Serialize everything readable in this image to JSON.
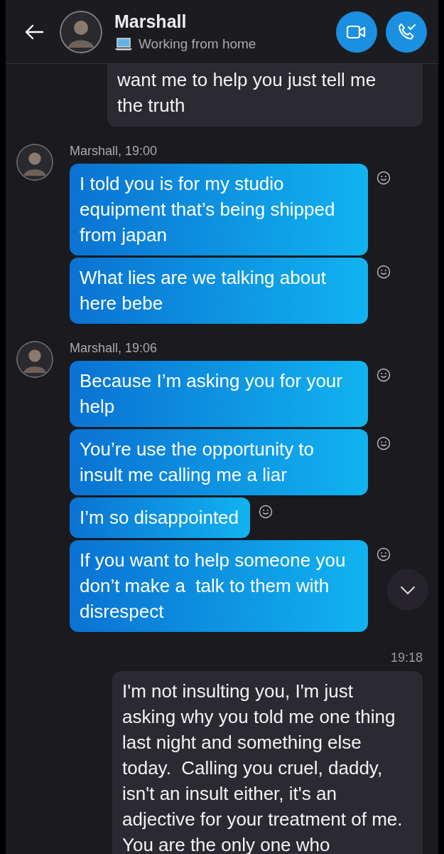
{
  "header": {
    "contact_name": "Marshall",
    "status": "Working from home"
  },
  "messages": [
    {
      "kind": "outgoing",
      "text": "want me to help you just tell me the truth"
    },
    {
      "kind": "incoming",
      "caption": "Marshall, 19:00",
      "bubbles": [
        "I told you is for my studio equipment that’s being shipped from japan",
        "What lies are we talking about here bebe"
      ]
    },
    {
      "kind": "incoming",
      "caption": "Marshall, 19:06",
      "bubbles": [
        "Because I’m asking you for your help",
        "You’re use the opportunity to insult me calling me a liar",
        "I’m so disappointed",
        "If you want to help someone you don’t make a  talk to them with disrespect"
      ]
    },
    {
      "kind": "outgoing",
      "time": "19:18",
      "text": "I'm not insulting you, I'm just asking why you told me one thing last night and something else today.  Calling you cruel, daddy, isn't an insult either, it's an adjective for your treatment of me.  You are the only one who"
    }
  ]
}
